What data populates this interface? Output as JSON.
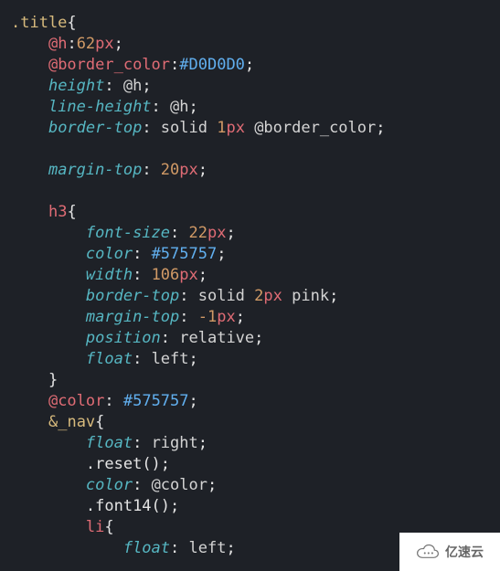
{
  "code": {
    "lines": [
      [
        {
          "t": ".title",
          "c": "sel"
        },
        {
          "t": "{",
          "c": "punct"
        }
      ],
      [
        {
          "t": "    ",
          "c": "tok"
        },
        {
          "t": "@h",
          "c": "var"
        },
        {
          "t": ":",
          "c": "punct"
        },
        {
          "t": "62",
          "c": "num"
        },
        {
          "t": "px",
          "c": "unit"
        },
        {
          "t": ";",
          "c": "punct"
        }
      ],
      [
        {
          "t": "    ",
          "c": "tok"
        },
        {
          "t": "@border_color",
          "c": "var"
        },
        {
          "t": ":",
          "c": "punct"
        },
        {
          "t": "#D0D0D0",
          "c": "hex"
        },
        {
          "t": ";",
          "c": "punct"
        }
      ],
      [
        {
          "t": "    ",
          "c": "tok"
        },
        {
          "t": "height",
          "c": "prop"
        },
        {
          "t": ": ",
          "c": "punct"
        },
        {
          "t": "@h",
          "c": "kw"
        },
        {
          "t": ";",
          "c": "punct"
        }
      ],
      [
        {
          "t": "    ",
          "c": "tok"
        },
        {
          "t": "line-height",
          "c": "prop"
        },
        {
          "t": ": ",
          "c": "punct"
        },
        {
          "t": "@h",
          "c": "kw"
        },
        {
          "t": ";",
          "c": "punct"
        }
      ],
      [
        {
          "t": "    ",
          "c": "tok"
        },
        {
          "t": "border-top",
          "c": "prop"
        },
        {
          "t": ": ",
          "c": "punct"
        },
        {
          "t": "solid ",
          "c": "kw"
        },
        {
          "t": "1",
          "c": "num"
        },
        {
          "t": "px",
          "c": "unit"
        },
        {
          "t": " @border_color",
          "c": "kw"
        },
        {
          "t": ";",
          "c": "punct"
        }
      ],
      [],
      [
        {
          "t": "    ",
          "c": "tok"
        },
        {
          "t": "margin-top",
          "c": "prop"
        },
        {
          "t": ": ",
          "c": "punct"
        },
        {
          "t": "20",
          "c": "num"
        },
        {
          "t": "px",
          "c": "unit"
        },
        {
          "t": ";",
          "c": "punct"
        }
      ],
      [],
      [
        {
          "t": "    ",
          "c": "tok"
        },
        {
          "t": "h3",
          "c": "var"
        },
        {
          "t": "{",
          "c": "punct"
        }
      ],
      [
        {
          "t": "        ",
          "c": "tok"
        },
        {
          "t": "font-size",
          "c": "prop"
        },
        {
          "t": ": ",
          "c": "punct"
        },
        {
          "t": "22",
          "c": "num"
        },
        {
          "t": "px",
          "c": "unit"
        },
        {
          "t": ";",
          "c": "punct"
        }
      ],
      [
        {
          "t": "        ",
          "c": "tok"
        },
        {
          "t": "color",
          "c": "prop"
        },
        {
          "t": ": ",
          "c": "punct"
        },
        {
          "t": "#575757",
          "c": "hex"
        },
        {
          "t": ";",
          "c": "punct"
        }
      ],
      [
        {
          "t": "        ",
          "c": "tok"
        },
        {
          "t": "width",
          "c": "prop"
        },
        {
          "t": ": ",
          "c": "punct"
        },
        {
          "t": "106",
          "c": "num"
        },
        {
          "t": "px",
          "c": "unit"
        },
        {
          "t": ";",
          "c": "punct"
        }
      ],
      [
        {
          "t": "        ",
          "c": "tok"
        },
        {
          "t": "border-top",
          "c": "prop"
        },
        {
          "t": ": ",
          "c": "punct"
        },
        {
          "t": "solid ",
          "c": "kw"
        },
        {
          "t": "2",
          "c": "num"
        },
        {
          "t": "px",
          "c": "unit"
        },
        {
          "t": " pink",
          "c": "kw"
        },
        {
          "t": ";",
          "c": "punct"
        }
      ],
      [
        {
          "t": "        ",
          "c": "tok"
        },
        {
          "t": "margin-top",
          "c": "prop"
        },
        {
          "t": ": ",
          "c": "punct"
        },
        {
          "t": "-1",
          "c": "num"
        },
        {
          "t": "px",
          "c": "unit"
        },
        {
          "t": ";",
          "c": "punct"
        }
      ],
      [
        {
          "t": "        ",
          "c": "tok"
        },
        {
          "t": "position",
          "c": "prop"
        },
        {
          "t": ": ",
          "c": "punct"
        },
        {
          "t": "relative",
          "c": "kw"
        },
        {
          "t": ";",
          "c": "punct"
        }
      ],
      [
        {
          "t": "        ",
          "c": "tok"
        },
        {
          "t": "float",
          "c": "prop"
        },
        {
          "t": ": ",
          "c": "punct"
        },
        {
          "t": "left",
          "c": "kw"
        },
        {
          "t": ";",
          "c": "punct"
        }
      ],
      [
        {
          "t": "    ",
          "c": "tok"
        },
        {
          "t": "}",
          "c": "punct"
        }
      ],
      [
        {
          "t": "    ",
          "c": "tok"
        },
        {
          "t": "@color",
          "c": "var"
        },
        {
          "t": ": ",
          "c": "punct"
        },
        {
          "t": "#575757",
          "c": "hex"
        },
        {
          "t": ";",
          "c": "punct"
        }
      ],
      [
        {
          "t": "    ",
          "c": "tok"
        },
        {
          "t": "&",
          "c": "amp"
        },
        {
          "t": "_",
          "c": "upunct"
        },
        {
          "t": "nav",
          "c": "sel"
        },
        {
          "t": "{",
          "c": "punct"
        }
      ],
      [
        {
          "t": "        ",
          "c": "tok"
        },
        {
          "t": "float",
          "c": "prop"
        },
        {
          "t": ": ",
          "c": "punct"
        },
        {
          "t": "right",
          "c": "kw"
        },
        {
          "t": ";",
          "c": "punct"
        }
      ],
      [
        {
          "t": "        ",
          "c": "tok"
        },
        {
          "t": ".reset",
          "c": "mixin"
        },
        {
          "t": "();",
          "c": "punct"
        }
      ],
      [
        {
          "t": "        ",
          "c": "tok"
        },
        {
          "t": "color",
          "c": "prop"
        },
        {
          "t": ": ",
          "c": "punct"
        },
        {
          "t": "@color",
          "c": "kw"
        },
        {
          "t": ";",
          "c": "punct"
        }
      ],
      [
        {
          "t": "        ",
          "c": "tok"
        },
        {
          "t": ".font14",
          "c": "mixin"
        },
        {
          "t": "();",
          "c": "punct"
        }
      ],
      [
        {
          "t": "        ",
          "c": "tok"
        },
        {
          "t": "li",
          "c": "var"
        },
        {
          "t": "{",
          "c": "punct"
        }
      ],
      [
        {
          "t": "            ",
          "c": "tok"
        },
        {
          "t": "float",
          "c": "prop"
        },
        {
          "t": ": ",
          "c": "punct"
        },
        {
          "t": "left",
          "c": "kw"
        },
        {
          "t": ";",
          "c": "punct"
        }
      ]
    ]
  },
  "watermark": {
    "text": "亿速云"
  }
}
